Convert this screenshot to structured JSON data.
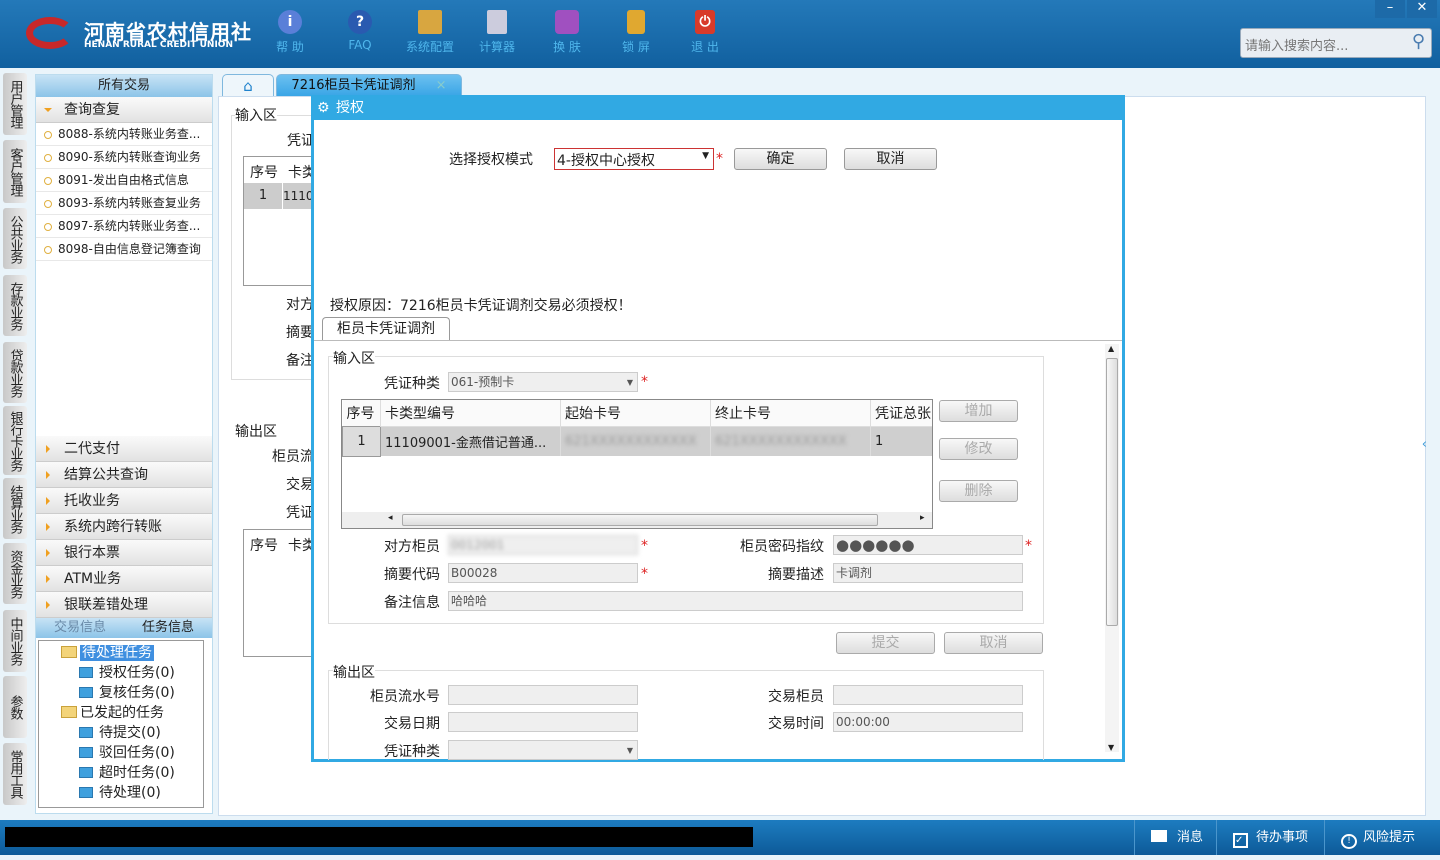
{
  "header": {
    "logo_cn": "河南省农村信用社",
    "logo_en": "HENAN RURAL CREDIT UNION",
    "tools": [
      {
        "label": "帮 助",
        "icon": "info-icon"
      },
      {
        "label": "FAQ",
        "icon": "help-icon"
      },
      {
        "label": "系统配置",
        "icon": "toolbox-icon"
      },
      {
        "label": "计算器",
        "icon": "calculator-icon"
      },
      {
        "label": "换 肤",
        "icon": "shirt-icon"
      },
      {
        "label": "锁 屏",
        "icon": "lock-icon"
      },
      {
        "label": "退 出",
        "icon": "power-icon"
      }
    ],
    "search_placeholder": "请输入搜索内容...",
    "minimize": "–",
    "close": "✕"
  },
  "vtabs": [
    "用户管理",
    "客户管理",
    "公共业务",
    "存款业务",
    "贷款业务",
    "银行卡业务",
    "结算业务",
    "资金业务",
    "中间业务",
    "参数",
    "常用工具"
  ],
  "left": {
    "title": "所有交易",
    "open_category": "查询查复",
    "items": [
      "8088-系统内转账业务查...",
      "8090-系统内转账查询业务",
      "8091-发出自由格式信息",
      "8093-系统内转账查复业务",
      "8097-系统内转账业务查...",
      "8098-自由信息登记簿查询"
    ],
    "categories": [
      "二代支付",
      "结算公共查询",
      "托收业务",
      "系统内跨行转账",
      "银行本票",
      "ATM业务",
      "银联差错处理"
    ],
    "tree_tabs": [
      "交易信息",
      "任务信息"
    ],
    "tree": {
      "pending": "待处理任务",
      "pending_children": [
        "授权任务(0)",
        "复核任务(0)"
      ],
      "initiated": "已发起的任务",
      "initiated_children": [
        "待提交(0)",
        "驳回任务(0)",
        "超时任务(0)",
        "待处理(0)"
      ]
    }
  },
  "tabs": {
    "active": "7216柜员卡凭证调剂",
    "close": "×"
  },
  "bg": {
    "input_area": "输入区",
    "output_area": "输出区",
    "voucher": "凭证",
    "seq": "序号",
    "card": "卡类",
    "row_seq": "1",
    "row_card": "1110",
    "counter": "对方",
    "summary": "摘要",
    "remark": "备注",
    "teller": "柜员流",
    "trade": "交易",
    "voucher2": "凭证",
    "seq2": "序号",
    "card2": "卡类"
  },
  "dialog": {
    "title": "授权",
    "mode_label": "选择授权模式",
    "mode_value": "4-授权中心授权",
    "ok": "确定",
    "cancel": "取消",
    "reason": "授权原因：7216柜员卡凭证调剂交易必须授权！",
    "tab": "柜员卡凭证调剂",
    "input_area": "输入区",
    "voucher_type_label": "凭证种类",
    "voucher_type_value": "061-预制卡",
    "columns": [
      "序号",
      "卡类型编号",
      "起始卡号",
      "终止卡号",
      "凭证总张"
    ],
    "row": {
      "seq": "1",
      "card_type": "11109001-金燕借记普通...",
      "start": "621XXXXXXXXXXXX",
      "end": "621XXXXXXXXXXXX",
      "total": "1"
    },
    "add": "增加",
    "modify": "修改",
    "delete": "删除",
    "counter_teller_label": "对方柜员",
    "counter_teller_value": "0012001",
    "pwd_label": "柜员密码指纹",
    "pwd_value": "●●●●●●",
    "summary_code_label": "摘要代码",
    "summary_code_value": "B00028",
    "summary_desc_label": "摘要描述",
    "summary_desc_value": "卡调剂",
    "remark_label": "备注信息",
    "remark_value": "哈哈哈",
    "submit": "提交",
    "cancel2": "取消",
    "output_area": "输出区",
    "serial_label": "柜员流水号",
    "trade_teller_label": "交易柜员",
    "date_label": "交易日期",
    "time_label": "交易时间",
    "time_value": "00:00:00",
    "voucher_type2_label": "凭证种类"
  },
  "status": {
    "message": "消息",
    "todo": "待办事项",
    "risk": "风险提示"
  }
}
